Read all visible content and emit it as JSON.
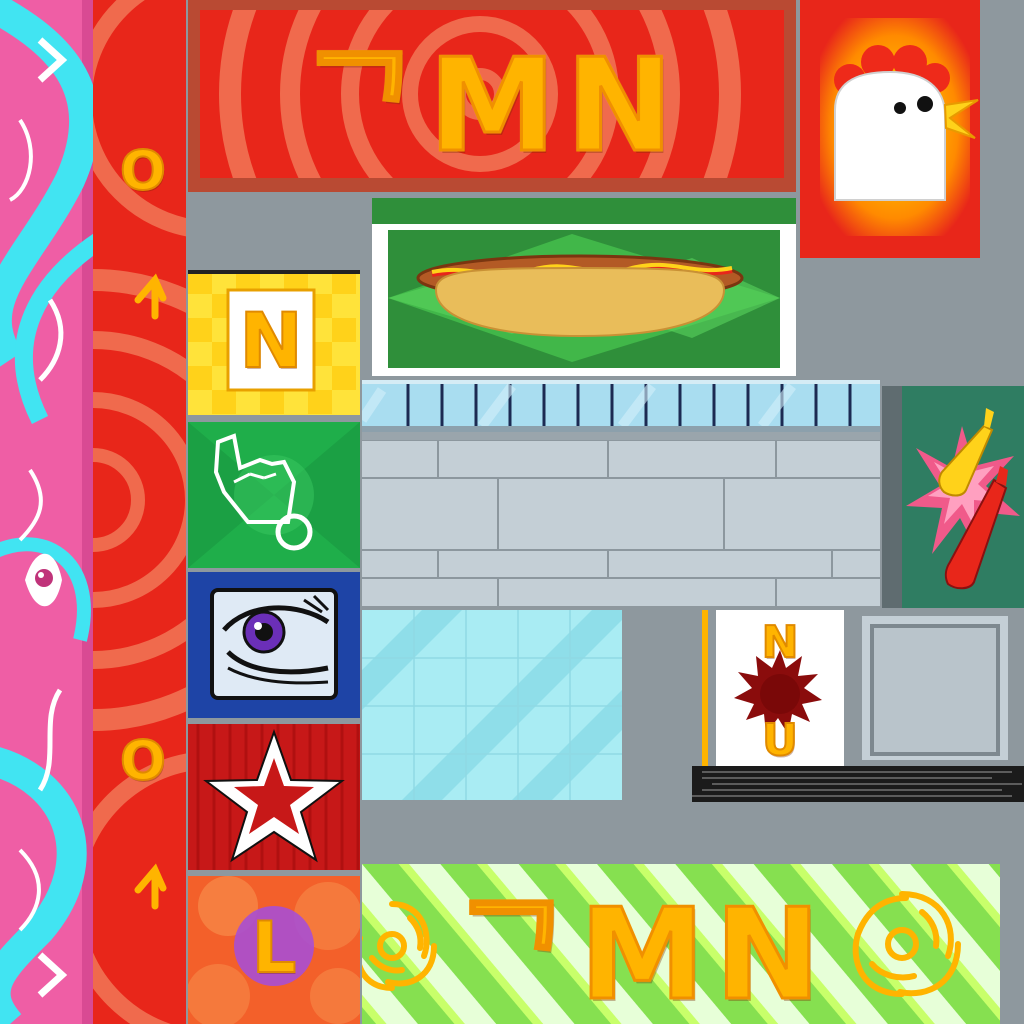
{
  "sign_top": {
    "text": "ᄀMN"
  },
  "sign_bottom": {
    "text": "ᄀMN"
  },
  "panel_letter_n": {
    "text": "N"
  },
  "panel_letter_l": {
    "text": "L"
  },
  "sticker_letters": {
    "top": "N",
    "bottom": "U"
  },
  "strip_symbols": {
    "top": "O",
    "bottom": "O"
  },
  "colors": {
    "sign_red": "#e8261a",
    "strip_red": "#e8261a",
    "pink_strip": "#ef5ea5",
    "cyan_swirl": "#41e4f2",
    "hotdog_green": "#2f8f3a",
    "glass": "#a9ecf3",
    "wall_tile": "#c4cfd6",
    "letter_gold": "#ffb400"
  },
  "icons": [
    "chicken-mascot-icon",
    "hotdog-icon",
    "pointing-hand-icon",
    "eye-icon",
    "star-icon",
    "mustard-bottle-icon",
    "ketchup-bottle-icon",
    "spiral-icon",
    "swirl-emblem-icon",
    "splat-icon"
  ]
}
